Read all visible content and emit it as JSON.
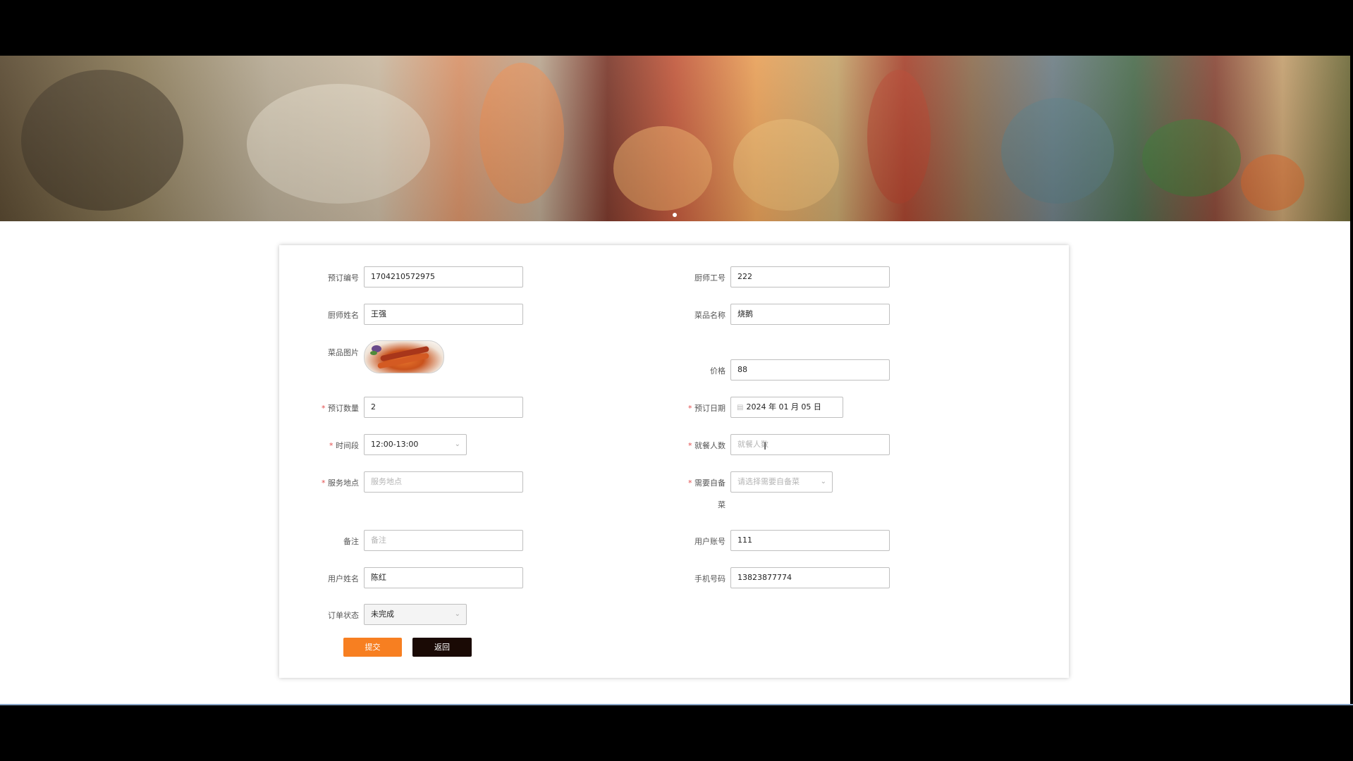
{
  "form": {
    "order_no": {
      "label": "预订编号",
      "value": "1704210572975"
    },
    "chef_no": {
      "label": "厨师工号",
      "value": "222"
    },
    "chef_name": {
      "label": "厨师姓名",
      "value": "王强"
    },
    "dish_name": {
      "label": "菜品名称",
      "value": "烧鹅"
    },
    "dish_image": {
      "label": "菜品图片"
    },
    "price": {
      "label": "价格",
      "value": "88"
    },
    "quantity": {
      "label": "预订数量",
      "value": "2"
    },
    "date": {
      "label": "预订日期",
      "value": "2024 年 01 月 05 日"
    },
    "time_slot": {
      "label": "时间段",
      "value": "12:00-13:00"
    },
    "diners": {
      "label": "就餐人数",
      "placeholder": "就餐人数"
    },
    "address": {
      "label": "服务地点",
      "placeholder": "服务地点"
    },
    "self_prep": {
      "label_line1": "需要自备",
      "label_line2": "菜",
      "placeholder": "请选择需要自备菜"
    },
    "remark": {
      "label": "备注",
      "placeholder": "备注"
    },
    "user_account": {
      "label": "用户账号",
      "value": "111"
    },
    "user_name": {
      "label": "用户姓名",
      "value": "陈红"
    },
    "phone": {
      "label": "手机号码",
      "value": "13823877774"
    },
    "status": {
      "label": "订单状态",
      "value": "未完成"
    }
  },
  "buttons": {
    "submit": "提交",
    "back": "返回"
  },
  "icons": {
    "calendar": "calendar-icon",
    "chevron": "chevron-down-icon"
  },
  "colors": {
    "submit": "#f77f21",
    "back": "#1a0a05",
    "required": "#e24c4c"
  }
}
